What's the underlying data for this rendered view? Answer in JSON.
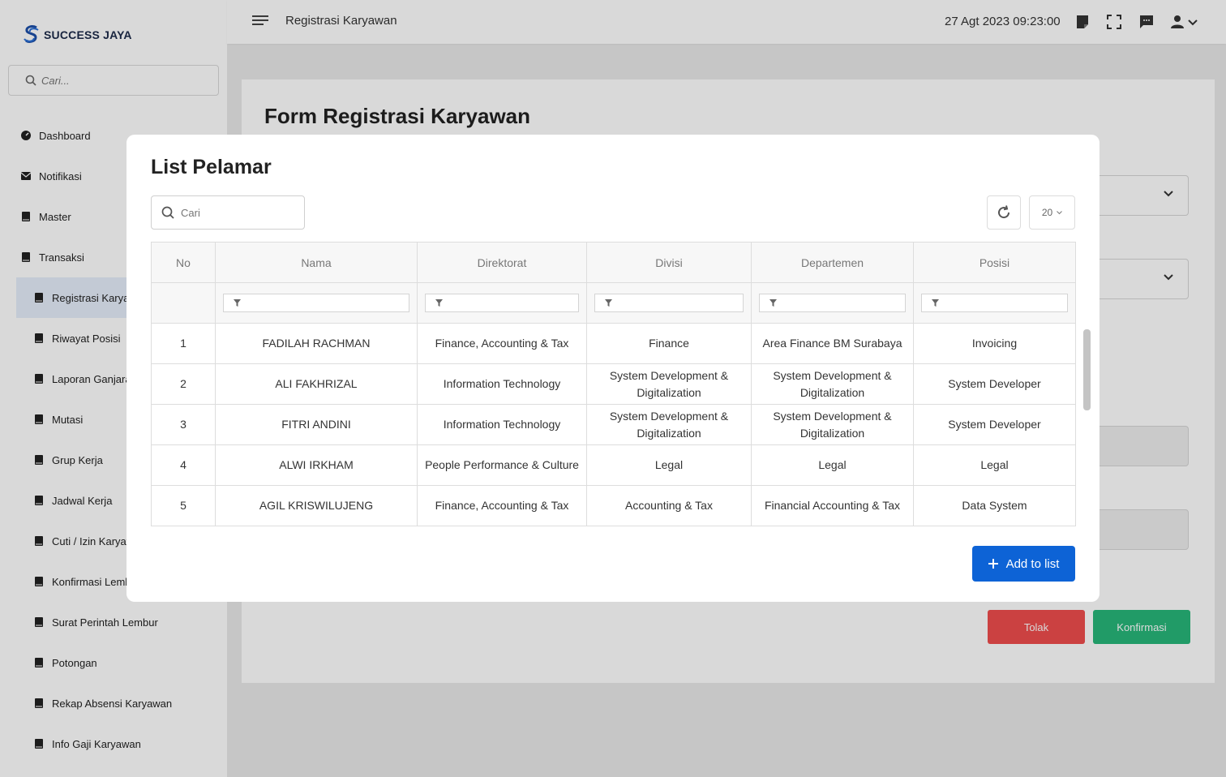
{
  "brand": {
    "name": "SUCCESS JAYA"
  },
  "sidebar": {
    "search_placeholder": "Cari...",
    "items": [
      {
        "label": "Dashboard",
        "icon": "dashboard-icon"
      },
      {
        "label": "Notifikasi",
        "icon": "envelope-icon"
      },
      {
        "label": "Master",
        "icon": "book-icon"
      },
      {
        "label": "Transaksi",
        "icon": "book-icon"
      }
    ],
    "sub_items": [
      {
        "label": "Registrasi Karyawan",
        "active": true
      },
      {
        "label": "Riwayat Posisi"
      },
      {
        "label": "Laporan Ganjaran"
      },
      {
        "label": "Mutasi"
      },
      {
        "label": "Grup Kerja"
      },
      {
        "label": "Jadwal Kerja"
      },
      {
        "label": "Cuti / Izin Karyawan"
      },
      {
        "label": "Konfirmasi Lembur"
      },
      {
        "label": "Surat Perintah Lembur"
      },
      {
        "label": "Potongan"
      },
      {
        "label": "Rekap Absensi Karyawan"
      },
      {
        "label": "Info Gaji Karyawan"
      }
    ]
  },
  "topbar": {
    "page_title": "Registrasi Karyawan",
    "datetime": "27 Agt 2023 09:23:00"
  },
  "main": {
    "form_title": "Form Registrasi Karyawan",
    "reject_label": "Tolak",
    "confirm_label": "Konfirmasi"
  },
  "modal": {
    "title": "List Pelamar",
    "search_placeholder": "Cari",
    "page_size": "20",
    "add_label": "Add to list",
    "columns": [
      "No",
      "Nama",
      "Direktorat",
      "Divisi",
      "Departemen",
      "Posisi"
    ],
    "rows": [
      [
        "1",
        "FADILAH RACHMAN",
        "Finance, Accounting & Tax",
        "Finance",
        "Area Finance BM Surabaya",
        "Invoicing"
      ],
      [
        "2",
        "ALI FAKHRIZAL",
        "Information Technology",
        "System Development & Digitalization",
        "System Development & Digitalization",
        "System Developer"
      ],
      [
        "3",
        "FITRI ANDINI",
        "Information Technology",
        "System Development & Digitalization",
        "System Development & Digitalization",
        "System Developer"
      ],
      [
        "4",
        "ALWI IRKHAM",
        "People Performance & Culture",
        "Legal",
        "Legal",
        "Legal"
      ],
      [
        "5",
        "AGIL KRISWILUJENG",
        "Finance, Accounting & Tax",
        "Accounting & Tax",
        "Financial Accounting & Tax",
        "Data System"
      ]
    ]
  },
  "colors": {
    "primary": "#0d63d6",
    "danger": "#ef4d4d",
    "success": "#27b77a",
    "brand": "#1d4fa8"
  }
}
